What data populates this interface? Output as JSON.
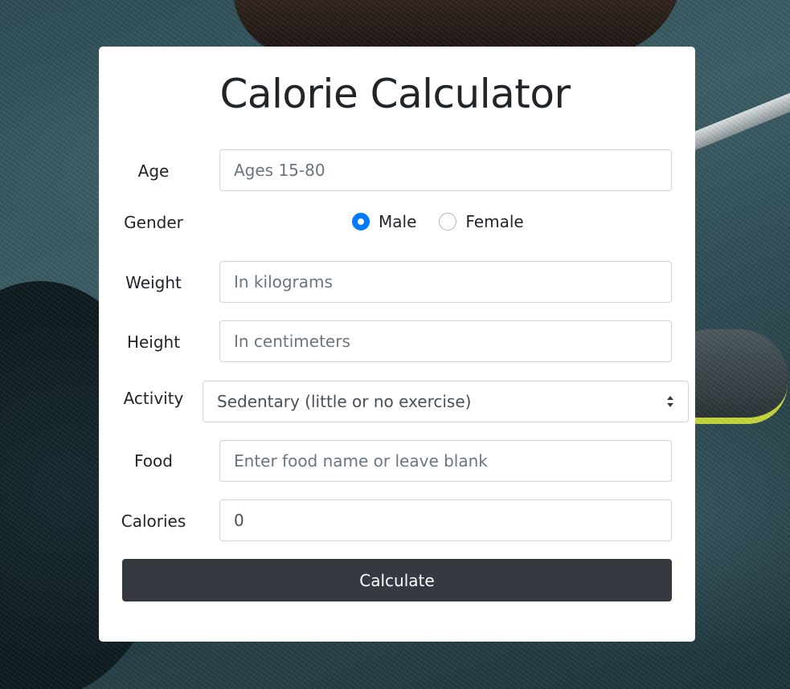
{
  "title": "Calorie Calculator",
  "labels": {
    "age": "Age",
    "gender": "Gender",
    "weight": "Weight",
    "height": "Height",
    "activity": "Activity",
    "food": "Food",
    "calories": "Calories"
  },
  "fields": {
    "age_placeholder": "Ages 15-80",
    "weight_placeholder": "In kilograms",
    "height_placeholder": "In centimeters",
    "food_placeholder": "Enter food name or leave blank",
    "calories_value": "0"
  },
  "gender": {
    "options": [
      {
        "label": "Male",
        "checked": true
      },
      {
        "label": "Female",
        "checked": false
      }
    ]
  },
  "activity": {
    "selected": "Sedentary (little or no exercise)"
  },
  "button": {
    "calculate": "Calculate"
  },
  "colors": {
    "accent": "#007bff",
    "button_bg": "#343a40"
  },
  "icons": {
    "select_arrow": "chevron-up-down-icon"
  }
}
